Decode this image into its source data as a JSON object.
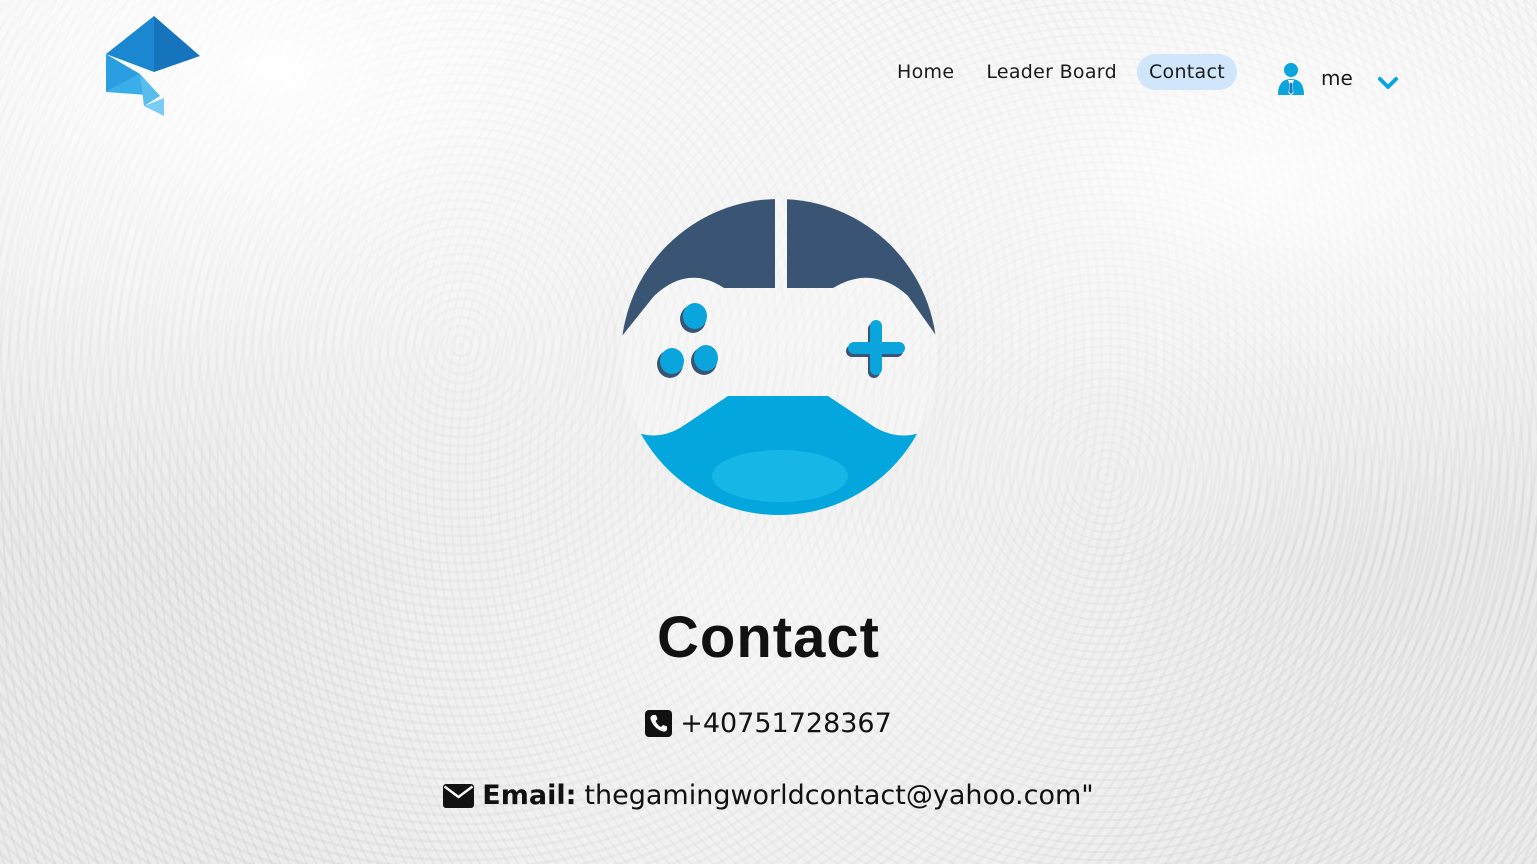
{
  "header": {
    "nav": [
      {
        "label": "Home"
      },
      {
        "label": "Leader Board"
      },
      {
        "label": "Contact"
      }
    ],
    "active_nav": "Contact",
    "user": {
      "name": "me",
      "icon": "user-icon",
      "menu_icon": "chevron-down-icon"
    }
  },
  "main": {
    "title": "Contact",
    "phone": {
      "icon": "phone-icon",
      "value": "+40751728367"
    },
    "email": {
      "icon": "envelope-icon",
      "label": "Email:",
      "value": "thegamingworldcontact@yahoo.com\""
    }
  },
  "colors": {
    "accent": "#0aa5dd",
    "dark_blue": "#3a5573",
    "nav_active_bg": "#cfe6fb",
    "logo_blue": "#1b87d0"
  }
}
